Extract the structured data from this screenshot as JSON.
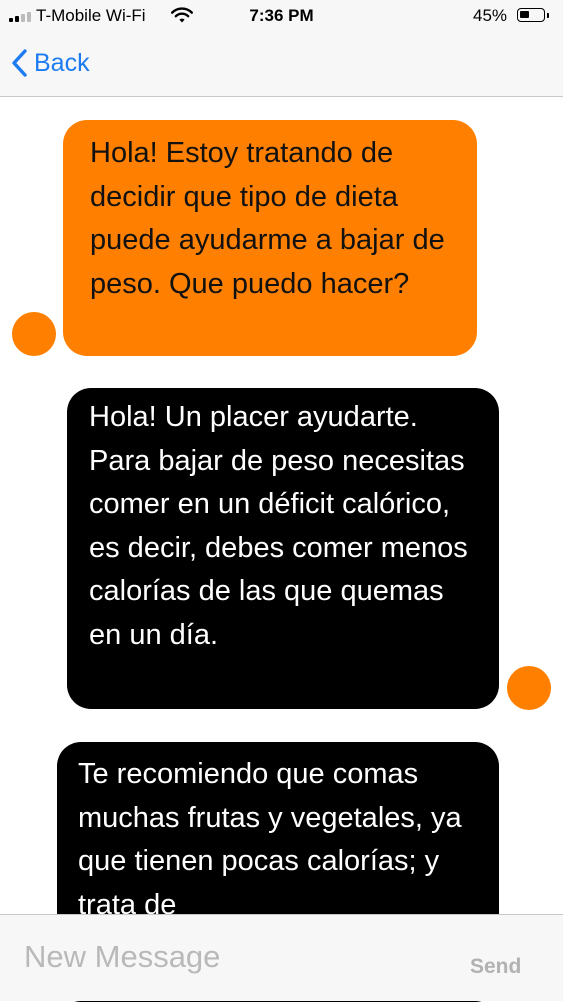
{
  "status_bar": {
    "carrier": "T-Mobile Wi-Fi",
    "time": "7:36 PM",
    "battery": "45%",
    "battery_level": 0.45,
    "icons": [
      "signal-icon",
      "wifi-icon",
      "battery-icon"
    ]
  },
  "nav": {
    "back_label": "Back",
    "back_icon": "chevron-left-icon",
    "accent_color": "#1d7cf2"
  },
  "messages": [
    {
      "sender": "user",
      "color": "#ff8000",
      "text": "Hola! Estoy tratando de decidir que tipo de dieta puede ayudarme a bajar de peso. Que puedo hacer?"
    },
    {
      "sender": "bot",
      "color": "#000000",
      "text": "Hola! Un placer ayudarte. Para bajar de peso necesitas comer en un déficit calórico, es decir, debes comer menos calorías de las que quemas en un día."
    },
    {
      "sender": "bot",
      "color": "#000000",
      "text": "Te recomiendo que comas muchas frutas y vegetales, ya que tienen pocas calorías; y trata de"
    }
  ],
  "composer": {
    "placeholder": "New Message",
    "send_label": "Send"
  }
}
